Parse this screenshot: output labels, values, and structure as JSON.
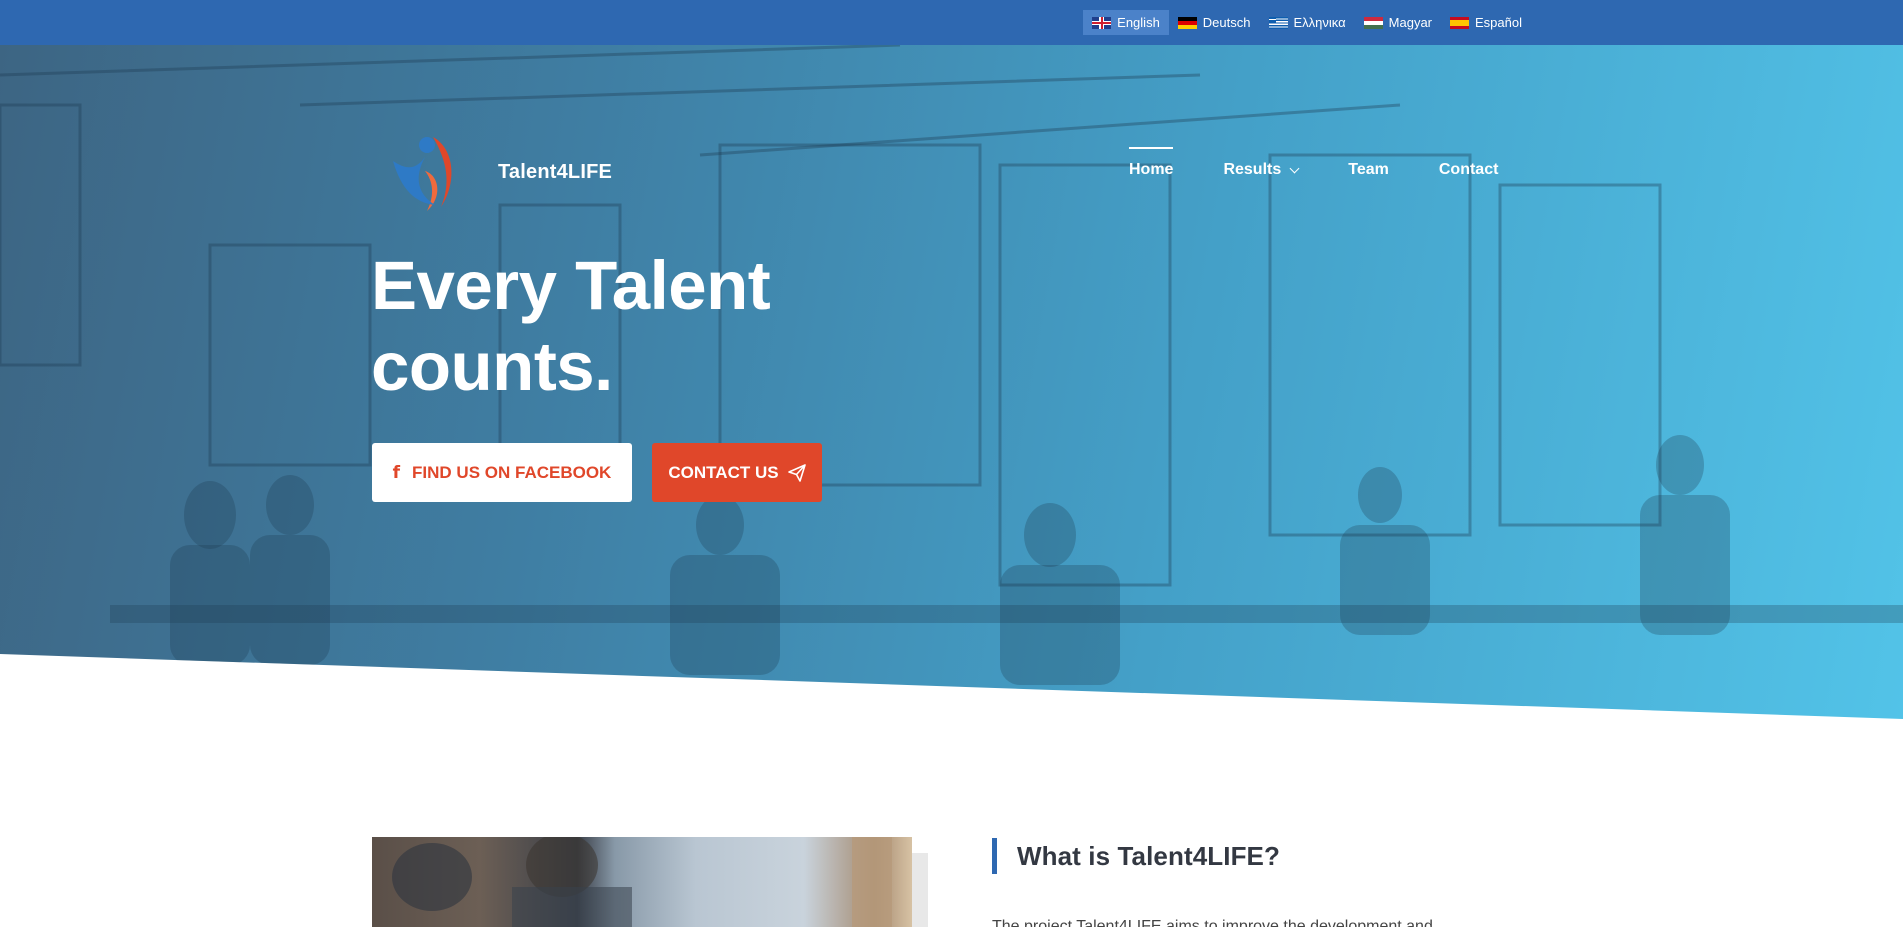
{
  "languages": [
    {
      "label": "English",
      "flag": "uk-flag-icon",
      "active": true
    },
    {
      "label": "Deutsch",
      "flag": "germany-flag-icon",
      "active": false
    },
    {
      "label": "Ελληνικα",
      "flag": "greece-flag-icon",
      "active": false
    },
    {
      "label": "Magyar",
      "flag": "hungary-flag-icon",
      "active": false
    },
    {
      "label": "Español",
      "flag": "spain-flag-icon",
      "active": false
    }
  ],
  "site": {
    "title": "Talent4LIFE",
    "logo_icon": "talent4life-logo-icon"
  },
  "nav": {
    "items": [
      {
        "label": "Home",
        "active": true
      },
      {
        "label": "Results",
        "has_dropdown": true
      },
      {
        "label": "Team"
      },
      {
        "label": "Contact"
      }
    ]
  },
  "hero": {
    "headline_line1": "Every Talent",
    "headline_line2": "counts.",
    "facebook_button": "FIND US ON FACEBOOK",
    "facebook_icon": "facebook-icon",
    "contact_button": "CONTACT US",
    "contact_icon": "paper-plane-icon"
  },
  "about": {
    "title": "What is Talent4LIFE?",
    "text": "The project Talent4LIFE aims to improve the development and"
  },
  "colors": {
    "topbar": "#2e68b1",
    "accent": "#e0472a",
    "hero_start": "#3d6583",
    "hero_end": "#52c3e8"
  }
}
